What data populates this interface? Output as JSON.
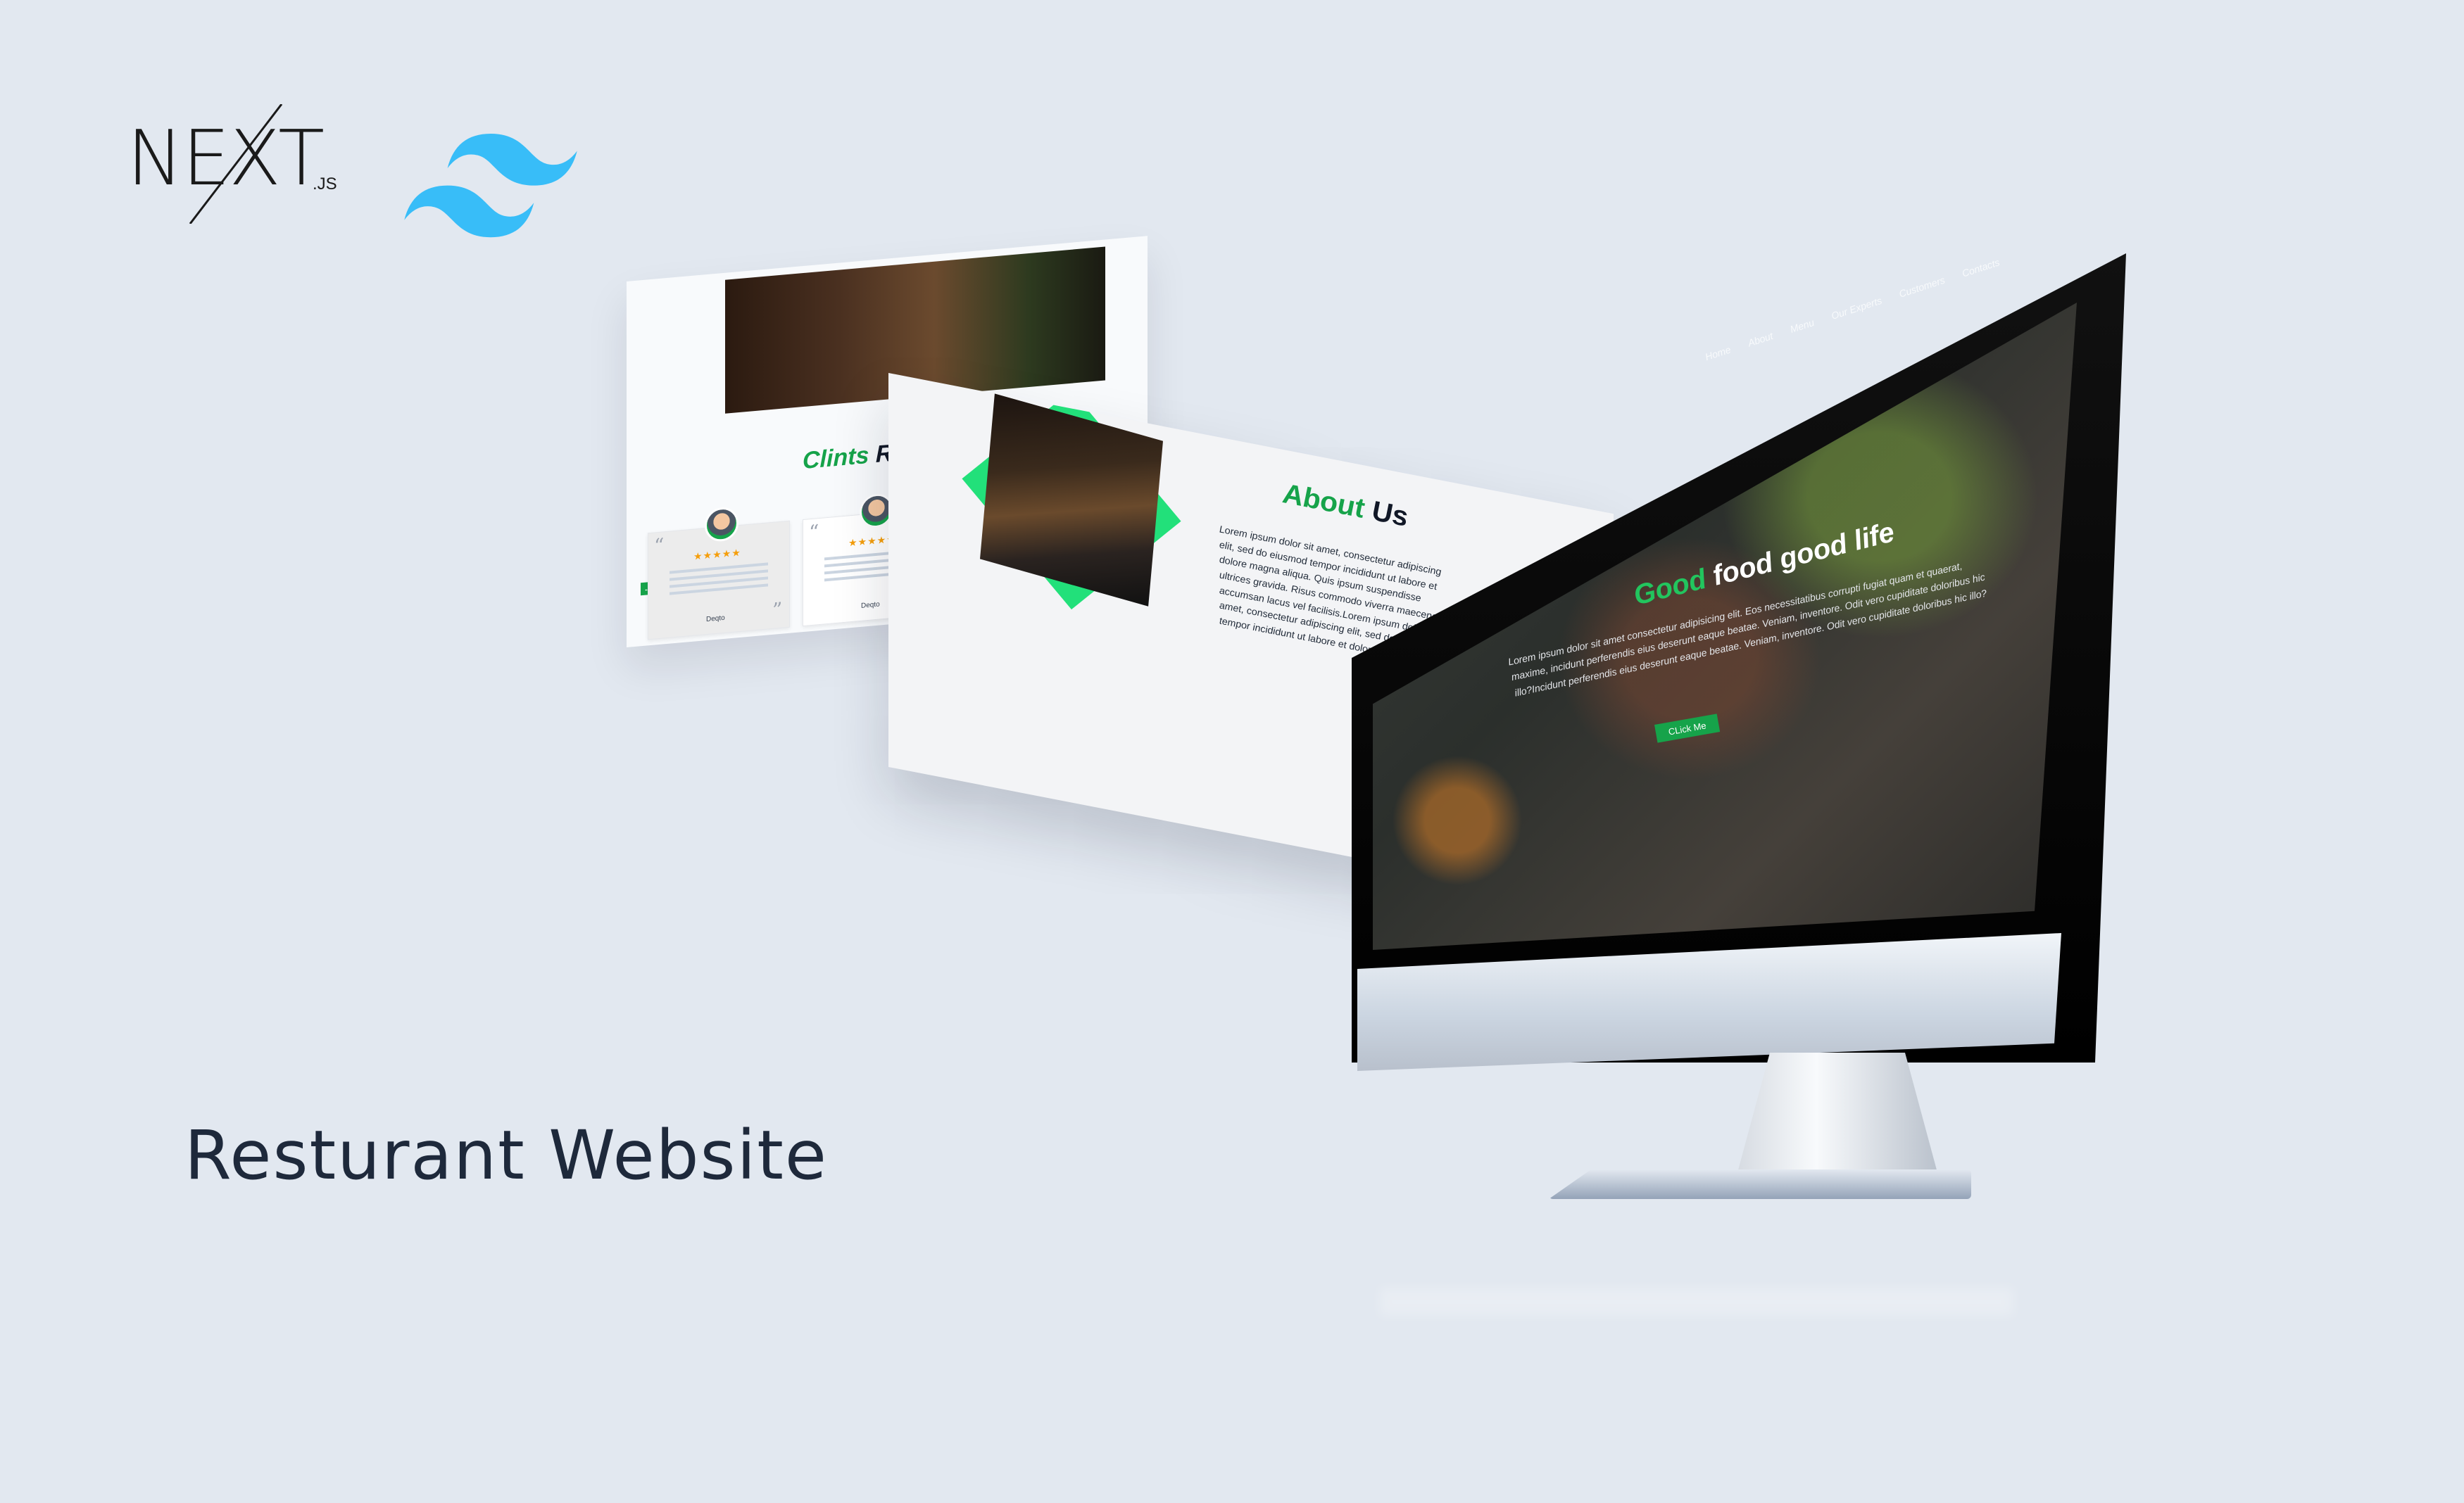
{
  "logos": {
    "next_word": "NEXT",
    "next_suffix": ".JS",
    "tailwind_color": "#38bdf8"
  },
  "page_title": "Resturant Website",
  "review_card": {
    "title_accent": "Clints",
    "title_rest": " Review",
    "stars": "★★★★★",
    "reviewer_1": "Deqto",
    "reviewer_2": "Deqto"
  },
  "about_card": {
    "title_accent": "About",
    "title_rest": " Us",
    "text": "Lorem ipsum dolor sit amet, consectetur adipiscing elit, sed do eiusmod tempor incididunt ut labore et dolore magna aliqua. Quis ipsum suspendisse ultrices gravida. Risus commodo viverra maecenas accumsan lacus vel facilisis.Lorem ipsum dolor sit amet, consectetur adipiscing elit, sed do eiusmod tempor incididunt ut labore et dolore"
  },
  "hero": {
    "nav": [
      "Home",
      "About",
      "Menu",
      "Our Experts",
      "Customers",
      "Contacts"
    ],
    "heading_accent": "Good",
    "heading_rest": " food good life",
    "text": "Lorem ipsum dolor sit amet consectetur adipisicing elit. Eos necessitatibus corrupti fugiat quam et quaerat, maxime, incidunt perferendis eius deserunt eaque beatae. Veniam, inventore. Odit vero cupiditate doloribus hic illo?Incidunt perferendis eius deserunt eaque beatae. Veniam, inventore. Odit vero cupiditate doloribus hic illo?",
    "button_label": "CLick Me",
    "accent_color": "#22c55e"
  }
}
